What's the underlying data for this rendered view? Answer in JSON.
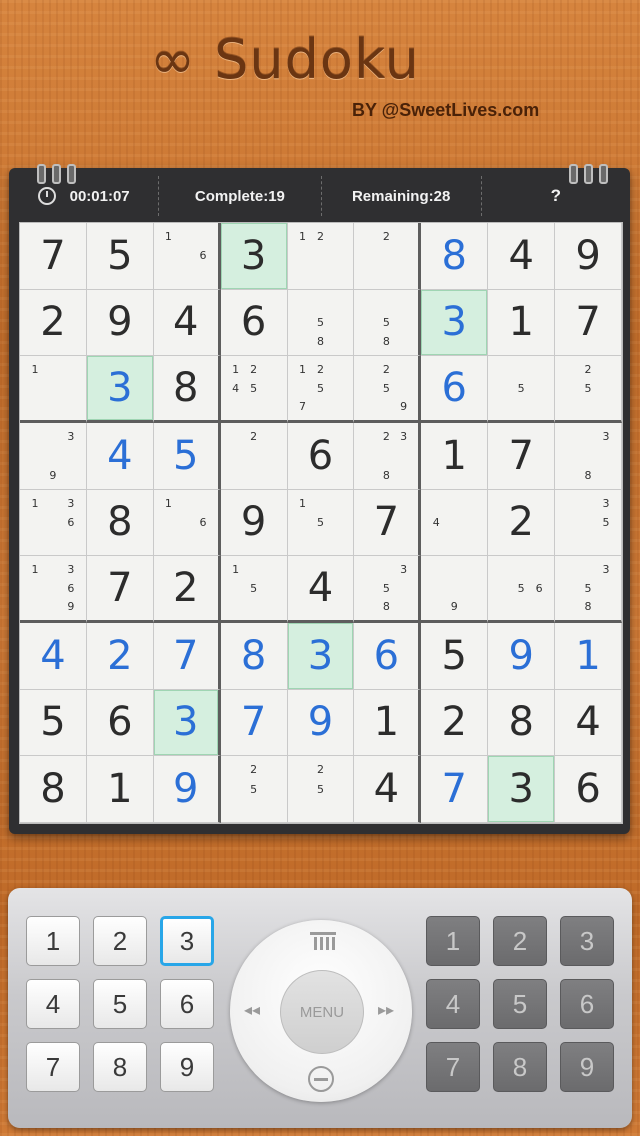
{
  "header": {
    "title": "∞ Sudoku",
    "byline": "BY @SweetLives.com"
  },
  "status": {
    "clock_icon": "clock-icon",
    "time": "00:01:07",
    "complete": "Complete:19",
    "remaining": "Remaining:28",
    "help": "?"
  },
  "board": {
    "rows": [
      [
        {
          "v": "7"
        },
        {
          "v": "5"
        },
        {
          "n": [
            "1",
            "",
            "",
            "",
            "",
            "6",
            "",
            "",
            ""
          ]
        },
        {
          "v": "3",
          "hl": true
        },
        {
          "n": [
            "1",
            "2",
            "",
            "",
            "",
            "",
            "",
            "",
            ""
          ]
        },
        {
          "n": [
            "",
            "2",
            "",
            "",
            "",
            "",
            "",
            "",
            ""
          ]
        },
        {
          "v": "8",
          "user": true
        },
        {
          "v": "4"
        },
        {
          "v": "9"
        }
      ],
      [
        {
          "v": "2"
        },
        {
          "v": "9"
        },
        {
          "v": "4"
        },
        {
          "v": "6"
        },
        {
          "n": [
            "",
            "",
            "",
            "",
            "5",
            "",
            "",
            "8",
            ""
          ]
        },
        {
          "n": [
            "",
            "",
            "",
            "",
            "5",
            "",
            "",
            "8",
            ""
          ]
        },
        {
          "v": "3",
          "user": true,
          "hl": true
        },
        {
          "v": "1"
        },
        {
          "v": "7"
        }
      ],
      [
        {
          "n": [
            "1",
            "",
            "",
            "",
            "",
            "",
            "",
            "",
            ""
          ]
        },
        {
          "v": "3",
          "user": true,
          "hl": true
        },
        {
          "v": "8"
        },
        {
          "n": [
            "1",
            "2",
            "",
            "4",
            "5",
            "",
            "",
            "",
            ""
          ]
        },
        {
          "n": [
            "1",
            "2",
            "",
            "",
            "5",
            "",
            "7",
            "",
            ""
          ]
        },
        {
          "n": [
            "",
            "2",
            "",
            "",
            "5",
            "",
            "",
            "",
            "9"
          ]
        },
        {
          "v": "6",
          "user": true
        },
        {
          "n": [
            "",
            "",
            "",
            "",
            "5",
            "",
            "",
            "",
            ""
          ]
        },
        {
          "n": [
            "",
            "2",
            "",
            "",
            "5",
            "",
            "",
            "",
            ""
          ]
        }
      ],
      [
        {
          "n": [
            "",
            "",
            "3",
            "",
            "",
            "",
            "",
            "9",
            ""
          ]
        },
        {
          "v": "4",
          "user": true
        },
        {
          "v": "5",
          "user": true
        },
        {
          "n": [
            "",
            "2",
            "",
            "",
            "",
            "",
            "",
            "",
            ""
          ]
        },
        {
          "v": "6"
        },
        {
          "n": [
            "",
            "2",
            "3",
            "",
            "",
            "",
            "",
            "8",
            ""
          ]
        },
        {
          "v": "1"
        },
        {
          "v": "7"
        },
        {
          "n": [
            "",
            "",
            "3",
            "",
            "",
            "",
            "",
            "8",
            ""
          ]
        }
      ],
      [
        {
          "n": [
            "1",
            "",
            "3",
            "",
            "",
            "6",
            "",
            "",
            ""
          ]
        },
        {
          "v": "8"
        },
        {
          "n": [
            "1",
            "",
            "",
            "",
            "",
            "6",
            "",
            "",
            ""
          ]
        },
        {
          "v": "9"
        },
        {
          "n": [
            "1",
            "",
            "",
            "",
            "5",
            "",
            "",
            "",
            ""
          ]
        },
        {
          "v": "7"
        },
        {
          "n": [
            "",
            "",
            "",
            "4",
            "",
            "",
            "",
            "",
            ""
          ]
        },
        {
          "v": "2"
        },
        {
          "n": [
            "",
            "",
            "3",
            "",
            "",
            "5",
            "",
            "",
            ""
          ]
        }
      ],
      [
        {
          "n": [
            "1",
            "",
            "3",
            "",
            "",
            "6",
            "",
            "",
            "9"
          ]
        },
        {
          "v": "7"
        },
        {
          "v": "2"
        },
        {
          "n": [
            "1",
            "",
            "",
            "",
            "5",
            "",
            "",
            "",
            ""
          ]
        },
        {
          "v": "4"
        },
        {
          "n": [
            "",
            "",
            "3",
            "",
            "5",
            "",
            "",
            "8",
            ""
          ]
        },
        {
          "n": [
            "",
            "",
            "",
            "",
            "",
            "",
            "",
            "9",
            ""
          ]
        },
        {
          "n": [
            "",
            "",
            "",
            "",
            "5",
            "6",
            "",
            "",
            ""
          ]
        },
        {
          "n": [
            "",
            "",
            "3",
            "",
            "5",
            "",
            "",
            "8",
            ""
          ]
        }
      ],
      [
        {
          "v": "4",
          "user": true
        },
        {
          "v": "2",
          "user": true
        },
        {
          "v": "7",
          "user": true
        },
        {
          "v": "8",
          "user": true
        },
        {
          "v": "3",
          "user": true,
          "hl": true
        },
        {
          "v": "6",
          "user": true
        },
        {
          "v": "5"
        },
        {
          "v": "9",
          "user": true
        },
        {
          "v": "1",
          "user": true
        }
      ],
      [
        {
          "v": "5"
        },
        {
          "v": "6"
        },
        {
          "v": "3",
          "user": true,
          "hl": true
        },
        {
          "v": "7",
          "user": true
        },
        {
          "v": "9",
          "user": true
        },
        {
          "v": "1"
        },
        {
          "v": "2"
        },
        {
          "v": "8"
        },
        {
          "v": "4"
        }
      ],
      [
        {
          "v": "8"
        },
        {
          "v": "1"
        },
        {
          "v": "9",
          "user": true
        },
        {
          "n": [
            "",
            "2",
            "",
            "",
            "5",
            "",
            "",
            "",
            ""
          ]
        },
        {
          "n": [
            "",
            "2",
            "",
            "",
            "5",
            "",
            "",
            "",
            ""
          ]
        },
        {
          "v": "4"
        },
        {
          "v": "7",
          "user": true
        },
        {
          "v": "3",
          "hl": true
        },
        {
          "v": "6"
        }
      ]
    ]
  },
  "keypad_left": [
    "1",
    "2",
    "3",
    "4",
    "5",
    "6",
    "7",
    "8",
    "9"
  ],
  "keypad_left_selected": "3",
  "keypad_right": [
    "1",
    "2",
    "3",
    "4",
    "5",
    "6",
    "7",
    "8",
    "9"
  ],
  "wheel": {
    "menu_label": "MENU",
    "top_icon": "trash-icon",
    "left_icon": "previous-icon",
    "right_icon": "next-icon",
    "bottom_icon": "minus-icon"
  }
}
